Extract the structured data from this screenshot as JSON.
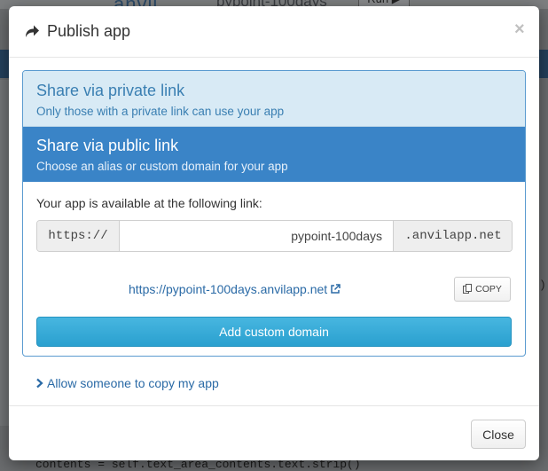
{
  "background": {
    "logo_text": "anvil",
    "app_name": "pypoint-100days",
    "run_label": "Run ▶",
    "code_line": "contents = self.text_area_contents.text.strip()",
    "right_glyph": ")"
  },
  "modal": {
    "title": "Publish app",
    "close_symbol": "×",
    "private_panel": {
      "title": "Share via private link",
      "subtitle": "Only those with a private link can use your app"
    },
    "public_panel": {
      "title": "Share via public link",
      "subtitle": "Choose an alias or custom domain for your app",
      "available_label": "Your app is available at the following link:",
      "url_prefix": "https://",
      "alias_value": "pypoint-100days",
      "url_suffix": ".anvilapp.net",
      "public_url": "https://pypoint-100days.anvilapp.net",
      "copy_label": "COPY",
      "add_domain_label": "Add custom domain"
    },
    "allow_copy_label": "Allow someone to copy my app",
    "close_button_label": "Close"
  },
  "colors": {
    "accent_blue": "#3a84c7",
    "light_blue_panel": "#d8eaf5",
    "link_blue": "#2a6aa6",
    "button_cyan": "#2aa0cf"
  },
  "icons": {
    "header": "share-arrow-icon",
    "external": "external-link-icon",
    "copy": "clipboard-icon",
    "expand": "chevron-right-icon"
  }
}
